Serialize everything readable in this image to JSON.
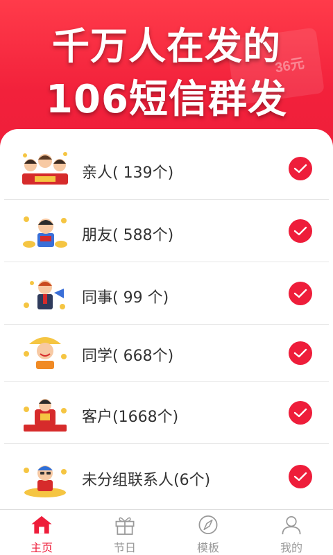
{
  "banner": {
    "line1": "千万人在发的",
    "line2": "106短信群发",
    "background_text": "36元"
  },
  "groups": [
    {
      "label": "亲人( 139个)",
      "selected": true,
      "icon": "family-illustration"
    },
    {
      "label": "朋友( 588个)",
      "selected": true,
      "icon": "friend-illustration"
    },
    {
      "label": "同事(  99 个)",
      "selected": true,
      "icon": "colleague-illustration"
    },
    {
      "label": "同学( 668个)",
      "selected": true,
      "icon": "classmate-illustration"
    },
    {
      "label": "客户(1668个)",
      "selected": true,
      "icon": "customer-illustration"
    },
    {
      "label": "未分组联系人(6个)",
      "selected": true,
      "icon": "ungrouped-illustration"
    }
  ],
  "tabs": [
    {
      "label": "主页",
      "icon": "home-icon",
      "active": true
    },
    {
      "label": "节日",
      "icon": "gift-icon",
      "active": false
    },
    {
      "label": "模板",
      "icon": "compass-icon",
      "active": false
    },
    {
      "label": "我的",
      "icon": "user-icon",
      "active": false
    }
  ],
  "colors": {
    "accent": "#ee1d3a",
    "banner_top": "#ff3b4a",
    "tab_inactive": "#999999",
    "text": "#333333"
  }
}
